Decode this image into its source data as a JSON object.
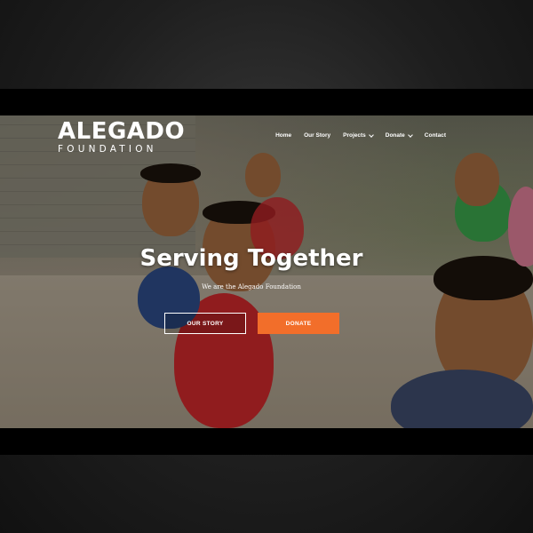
{
  "logo": {
    "main": "ALEGADO",
    "sub": "FOUNDATION"
  },
  "nav": [
    {
      "label": "Home",
      "dropdown": false
    },
    {
      "label": "Our Story",
      "dropdown": false
    },
    {
      "label": "Projects",
      "dropdown": true
    },
    {
      "label": "Donate",
      "dropdown": true
    },
    {
      "label": "Contact",
      "dropdown": false
    }
  ],
  "hero": {
    "title": "Serving Together",
    "subtitle": "We are the Alegado Foundation",
    "primary_button": "OUR STORY",
    "secondary_button": "DONATE"
  },
  "colors": {
    "accent": "#f26e2a",
    "text": "#ffffff"
  }
}
